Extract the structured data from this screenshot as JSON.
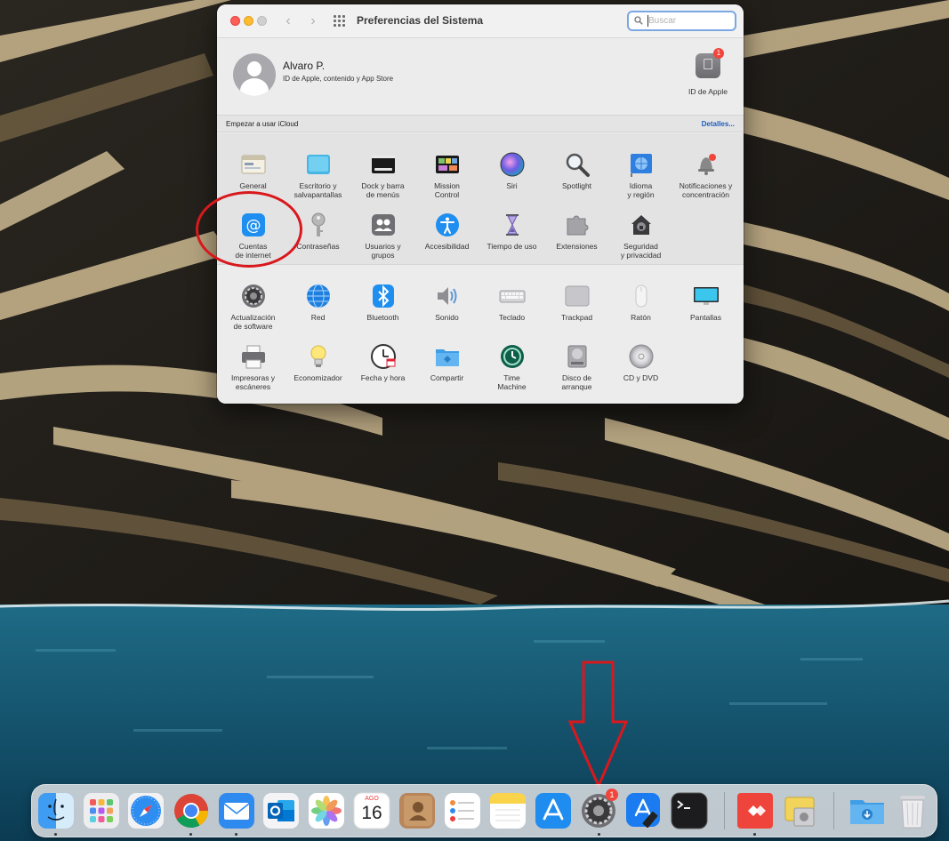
{
  "window": {
    "title": "Preferencias del Sistema",
    "search_placeholder": "Buscar"
  },
  "account": {
    "name": "Alvaro P.",
    "subtitle": "ID de Apple, contenido y App Store",
    "apple_id_label": "ID de Apple",
    "apple_id_badge": "1"
  },
  "icloud_bar": {
    "message": "Empezar a usar iCloud",
    "details": "Detalles..."
  },
  "section1": [
    {
      "id": "general",
      "label": "General",
      "icon": "general-icon"
    },
    {
      "id": "desktop",
      "label": "Escritorio y\nsalvapantallas",
      "icon": "desktop-icon"
    },
    {
      "id": "dock",
      "label": "Dock y barra\nde menús",
      "icon": "dock-icon"
    },
    {
      "id": "mission-control",
      "label": "Mission\nControl",
      "icon": "mission-control-icon"
    },
    {
      "id": "siri",
      "label": "Siri",
      "icon": "siri-icon"
    },
    {
      "id": "spotlight",
      "label": "Spotlight",
      "icon": "spotlight-icon"
    },
    {
      "id": "language",
      "label": "Idioma\ny región",
      "icon": "flag-icon"
    },
    {
      "id": "notifications",
      "label": "Notificaciones y\nconcentración",
      "icon": "bell-icon"
    },
    {
      "id": "internet-accounts",
      "label": "Cuentas\nde internet",
      "icon": "at-icon"
    },
    {
      "id": "passwords",
      "label": "Contraseñas",
      "icon": "key-icon"
    },
    {
      "id": "users",
      "label": "Usuarios y\ngrupos",
      "icon": "users-icon"
    },
    {
      "id": "accessibility",
      "label": "Accesibilidad",
      "icon": "accessibility-icon"
    },
    {
      "id": "screen-time",
      "label": "Tiempo de uso",
      "icon": "hourglass-icon"
    },
    {
      "id": "extensions",
      "label": "Extensiones",
      "icon": "puzzle-icon"
    },
    {
      "id": "security",
      "label": "Seguridad\ny privacidad",
      "icon": "house-lock-icon"
    }
  ],
  "section2": [
    {
      "id": "software-update",
      "label": "Actualización\nde software",
      "icon": "gear-icon"
    },
    {
      "id": "network",
      "label": "Red",
      "icon": "globe-icon"
    },
    {
      "id": "bluetooth",
      "label": "Bluetooth",
      "icon": "bluetooth-icon"
    },
    {
      "id": "sound",
      "label": "Sonido",
      "icon": "speaker-icon"
    },
    {
      "id": "keyboard",
      "label": "Teclado",
      "icon": "keyboard-icon"
    },
    {
      "id": "trackpad",
      "label": "Trackpad",
      "icon": "trackpad-icon"
    },
    {
      "id": "mouse",
      "label": "Ratón",
      "icon": "mouse-icon"
    },
    {
      "id": "displays",
      "label": "Pantallas",
      "icon": "display-icon"
    },
    {
      "id": "printers",
      "label": "Impresoras y\nescáneres",
      "icon": "printer-icon"
    },
    {
      "id": "energy",
      "label": "Economizador",
      "icon": "lightbulb-icon"
    },
    {
      "id": "date-time",
      "label": "Fecha y hora",
      "icon": "clock-icon"
    },
    {
      "id": "sharing",
      "label": "Compartir",
      "icon": "folder-icon"
    },
    {
      "id": "time-machine",
      "label": "Time\nMachine",
      "icon": "time-machine-icon"
    },
    {
      "id": "startup-disk",
      "label": "Disco de\narranque",
      "icon": "disk-icon"
    },
    {
      "id": "cd-dvd",
      "label": "CD y DVD",
      "icon": "cd-icon"
    }
  ],
  "dock": {
    "calendar_month": "AGO",
    "calendar_day": "16",
    "settings_badge": "1",
    "apps": [
      "finder",
      "launchpad",
      "safari",
      "chrome",
      "mail",
      "outlook",
      "photos",
      "calendar",
      "contacts",
      "reminders",
      "notes",
      "app-store",
      "system-preferences",
      "xcode",
      "terminal",
      "anydesk",
      "utility",
      "downloads",
      "trash"
    ]
  },
  "colors": {
    "annotation_red": "#d9181d",
    "link_blue": "#1f5fbf",
    "badge_red": "#f0463c"
  }
}
